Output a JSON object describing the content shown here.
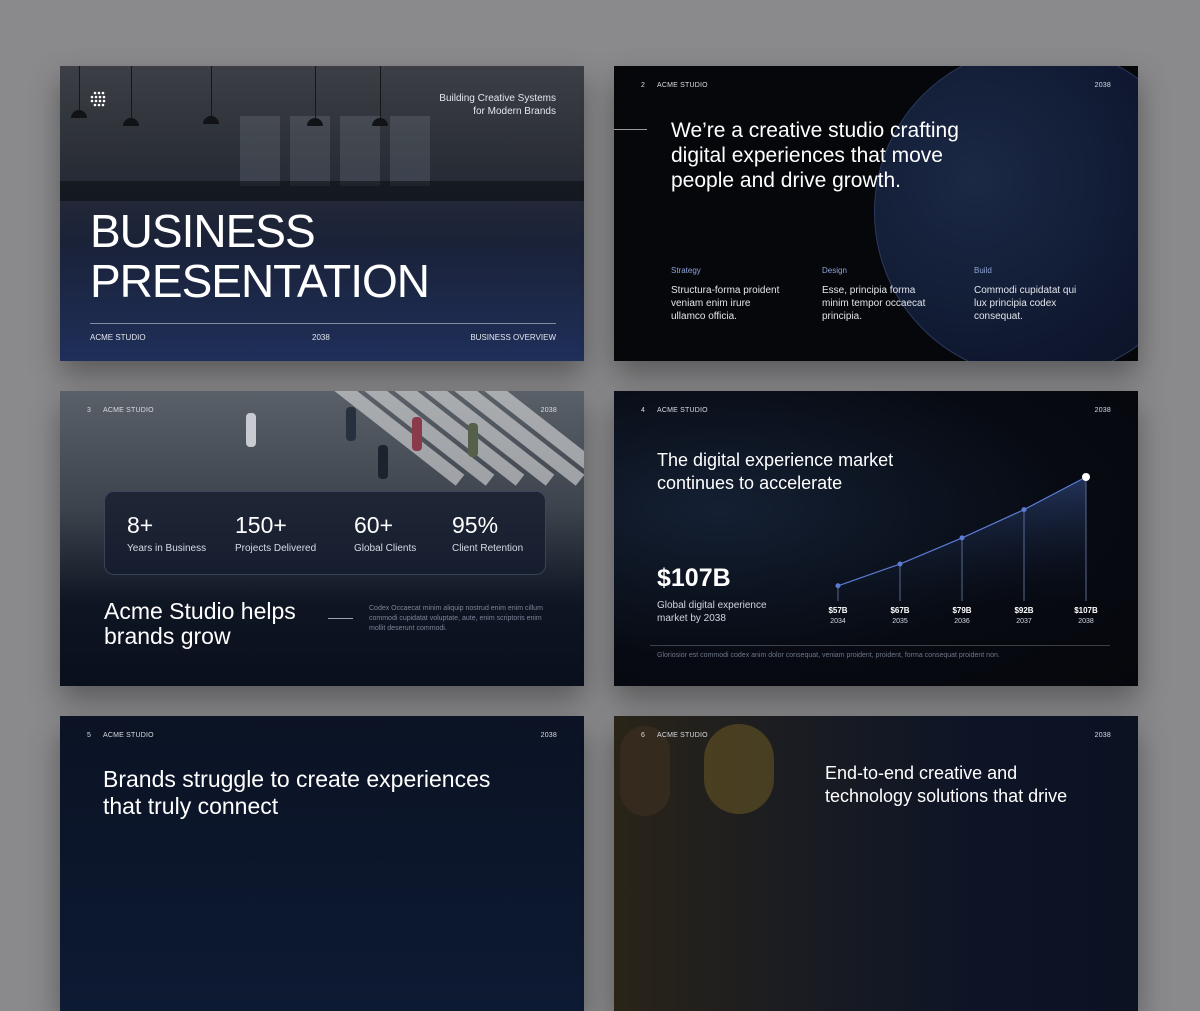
{
  "slide1": {
    "tagline": "Building Creative Systems\nfor Modern Brands",
    "title": "BUSINESS\nPRESENTATION",
    "footer_left": "ACME STUDIO",
    "footer_center": "2038",
    "footer_right": "BUSINESS OVERVIEW"
  },
  "slide2": {
    "number": "2",
    "brand": "ACME STUDIO",
    "year": "2038",
    "heading": "We’re a creative studio crafting digital experiences that move people and drive growth.",
    "columns": [
      {
        "title": "Strategy",
        "body": "Structura-forma proident veniam enim irure ullamco officia."
      },
      {
        "title": "Design",
        "body": "Esse, principia forma minim tempor occaecat principia."
      },
      {
        "title": "Build",
        "body": "Commodi cupidatat qui lux principia codex consequat."
      }
    ]
  },
  "slide3": {
    "number": "3",
    "brand": "ACME STUDIO",
    "year": "2038",
    "stats": [
      {
        "value": "8+",
        "label": "Years in Business"
      },
      {
        "value": "150+",
        "label": "Projects Delivered"
      },
      {
        "value": "60+",
        "label": "Global Clients"
      },
      {
        "value": "95%",
        "label": "Client Retention"
      }
    ],
    "headline": "Acme Studio helps brands grow",
    "paragraph": "Codex Occaecat minim aliquip nostrud enim enim cillum commodi cupidatat voluptate, aute, enim scriptoris enim mollit deserunt commodi."
  },
  "slide4": {
    "number": "4",
    "brand": "ACME STUDIO",
    "year": "2038",
    "heading": "The digital experience market continues to accelerate",
    "big_value": "$107B",
    "caption": "Global digital experience market by 2038",
    "fine_print": "Gloriosior est commodi codex anim dolor consequat, veniam proident, proident, forma consequat proident non.",
    "chart_data": {
      "type": "area",
      "categories": [
        "2034",
        "2035",
        "2036",
        "2037",
        "2038"
      ],
      "values": [
        57,
        67,
        79,
        92,
        107
      ],
      "labels": [
        "$57B",
        "$67B",
        "$79B",
        "$92B",
        "$107B"
      ],
      "accent": "#5b7bd5"
    }
  },
  "slide5": {
    "number": "5",
    "brand": "ACME STUDIO",
    "year": "2038",
    "heading": "Brands struggle to create experiences that truly connect"
  },
  "slide6": {
    "number": "6",
    "brand": "ACME STUDIO",
    "year": "2038",
    "heading": "End-to-end creative and technology solutions that drive"
  }
}
